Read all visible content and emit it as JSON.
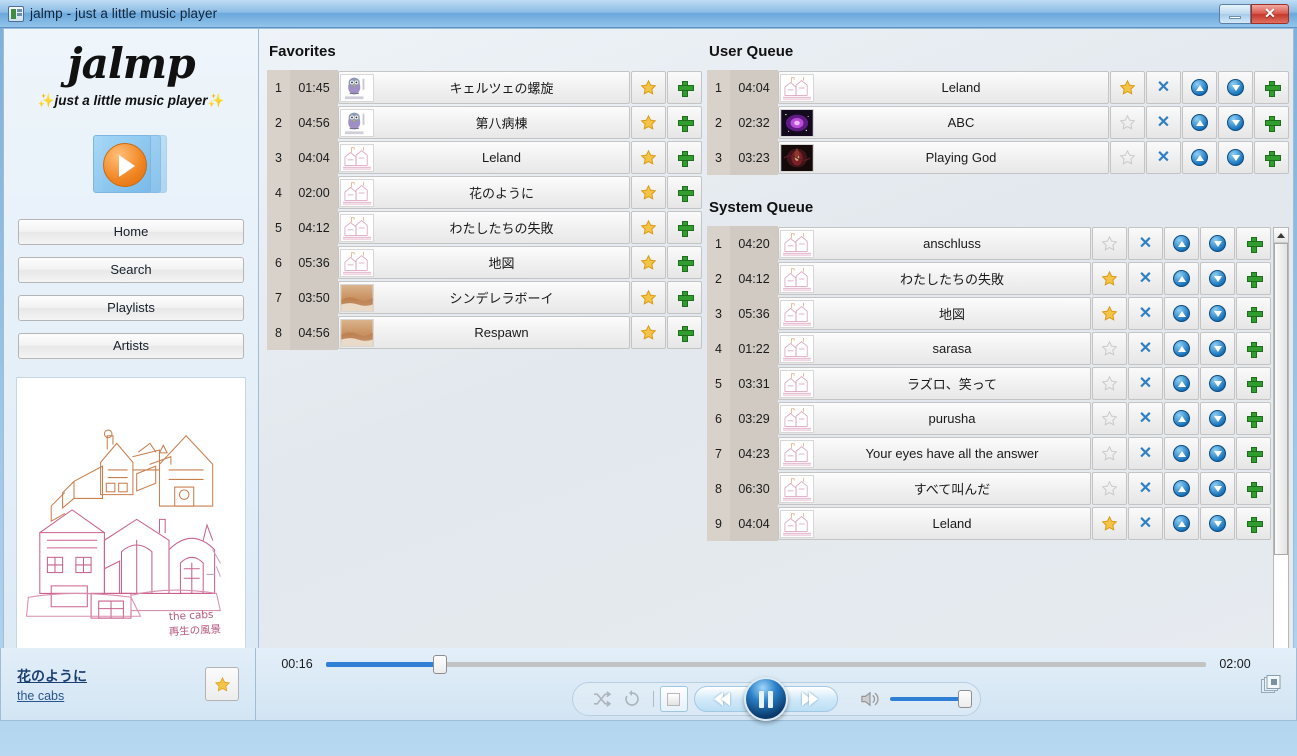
{
  "window": {
    "title": "jalmp - just a little music player",
    "icon": "window-icon",
    "minimize_label": "",
    "close_label": "✕"
  },
  "sidebar": {
    "brand": {
      "name": "jalmp",
      "tagline": "just a little music player",
      "sparkle": "✨",
      "logo_icon": "media-player-icon"
    },
    "nav": [
      {
        "label": "Home",
        "name": "home"
      },
      {
        "label": "Search",
        "name": "search"
      },
      {
        "label": "Playlists",
        "name": "playlists"
      },
      {
        "label": "Artists",
        "name": "artists"
      }
    ],
    "album_art": {
      "artist_caption": "the cabs",
      "album_caption": "再生の風景"
    }
  },
  "now_playing": {
    "title": "花のように",
    "artist": "the cabs",
    "favorite_icon": "star-filled-icon",
    "is_favorite": true
  },
  "favorites": {
    "heading": "Favorites",
    "tracks": [
      {
        "num": "1",
        "time": "01:45",
        "title": "キェルツェの螺旋",
        "art": "owl",
        "favorite": true
      },
      {
        "num": "2",
        "time": "04:56",
        "title": "第八病棟",
        "art": "owl",
        "favorite": true
      },
      {
        "num": "3",
        "time": "04:04",
        "title": "Leland",
        "art": "town",
        "favorite": true
      },
      {
        "num": "4",
        "time": "02:00",
        "title": "花のように",
        "art": "town",
        "favorite": true
      },
      {
        "num": "5",
        "time": "04:12",
        "title": "わたしたちの失敗",
        "art": "town",
        "favorite": true
      },
      {
        "num": "6",
        "time": "05:36",
        "title": "地図",
        "art": "town",
        "favorite": true
      },
      {
        "num": "7",
        "time": "03:50",
        "title": "シンデレラボーイ",
        "art": "desert",
        "favorite": true
      },
      {
        "num": "8",
        "time": "04:56",
        "title": "Respawn",
        "art": "desert",
        "favorite": true
      }
    ]
  },
  "user_queue": {
    "heading": "User Queue",
    "tracks": [
      {
        "num": "1",
        "time": "04:04",
        "title": "Leland",
        "art": "town",
        "favorite": true
      },
      {
        "num": "2",
        "time": "02:32",
        "title": "ABC",
        "art": "nebula",
        "favorite": false
      },
      {
        "num": "3",
        "time": "03:23",
        "title": "Playing God",
        "art": "dark",
        "favorite": false
      }
    ]
  },
  "system_queue": {
    "heading": "System Queue",
    "tracks": [
      {
        "num": "1",
        "time": "04:20",
        "title": "anschluss",
        "art": "town",
        "favorite": false
      },
      {
        "num": "2",
        "time": "04:12",
        "title": "わたしたちの失敗",
        "art": "town",
        "favorite": true
      },
      {
        "num": "3",
        "time": "05:36",
        "title": "地図",
        "art": "town",
        "favorite": true
      },
      {
        "num": "4",
        "time": "01:22",
        "title": "sarasa",
        "art": "town",
        "favorite": false
      },
      {
        "num": "5",
        "time": "03:31",
        "title": "ラズロ、笑って",
        "art": "town",
        "favorite": false
      },
      {
        "num": "6",
        "time": "03:29",
        "title": "purusha",
        "art": "town",
        "favorite": false
      },
      {
        "num": "7",
        "time": "04:23",
        "title": "Your eyes have all the answer",
        "art": "town",
        "favorite": false
      },
      {
        "num": "8",
        "time": "06:30",
        "title": "すべて叫んだ",
        "art": "town",
        "favorite": false
      },
      {
        "num": "9",
        "time": "04:04",
        "title": "Leland",
        "art": "town",
        "favorite": true
      }
    ]
  },
  "row_actions": {
    "favorite_icon": "star-icon",
    "remove_icon": "x-icon",
    "move_up_icon": "arrow-up-icon",
    "move_down_icon": "arrow-down-icon",
    "add_icon": "plus-icon"
  },
  "player": {
    "elapsed": "00:16",
    "duration": "02:00",
    "progress_percent": 13,
    "volume_percent": 100,
    "state": "playing",
    "shuffle_icon": "shuffle-icon",
    "repeat_icon": "repeat-icon",
    "stop_icon": "stop-icon",
    "prev_icon": "rewind-icon",
    "play_pause_icon": "pause-icon",
    "next_icon": "fast-forward-icon",
    "volume_icon": "speaker-icon",
    "layers_icon": "layers-icon"
  },
  "colors": {
    "accent_blue": "#2f7fd4",
    "title_bar": "#7eb0da",
    "star_gold": "#f5c23c",
    "plus_green": "#2f9e2f",
    "close_red": "#c4382c"
  }
}
